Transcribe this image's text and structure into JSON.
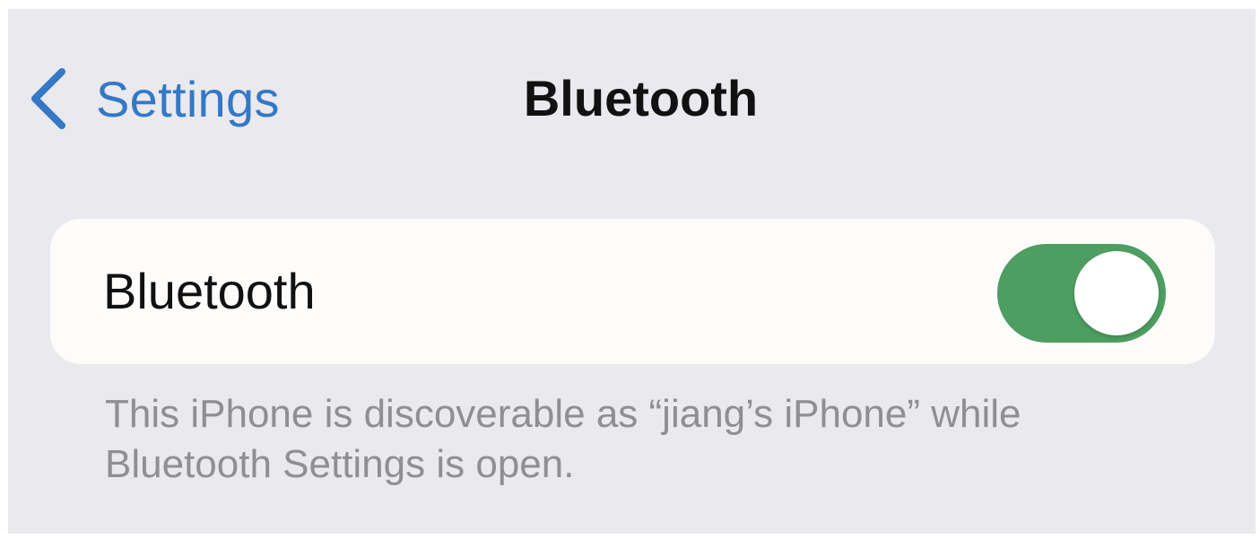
{
  "nav": {
    "back_label": "Settings",
    "title": "Bluetooth"
  },
  "bluetooth_row": {
    "label": "Bluetooth",
    "toggle_on": true
  },
  "footer": {
    "line1": "This iPhone is discoverable as “jiang’s iPhone” while",
    "line2": "Bluetooth Settings is open."
  },
  "colors": {
    "accent": "#3478c6",
    "toggle_on": "#4e9d61",
    "background": "#e9e9ee",
    "card": "#fdfcfb",
    "footer_text": "#8e8e93"
  },
  "icons": {
    "back": "chevron-left-icon"
  }
}
